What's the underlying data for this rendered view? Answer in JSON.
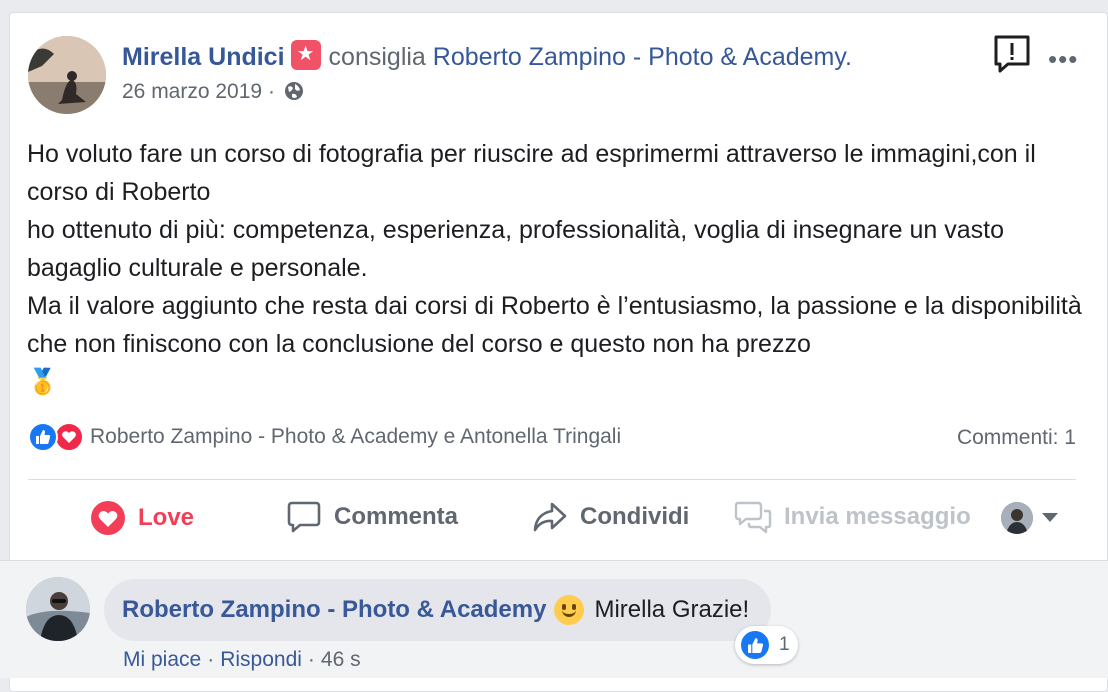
{
  "post": {
    "author": "Mirella Undici",
    "verb": "consiglia",
    "page": "Roberto Zampino - Photo & Academy.",
    "date": "26 marzo 2019",
    "date_sep": "·",
    "body": [
      "Ho voluto fare un corso di fotografia per riuscire ad esprimermi attraverso le immagini,con il corso di Roberto",
      "ho ottenuto di più: competenza, esperienza, professionalità, voglia di insegnare un vasto bagaglio culturale e personale.",
      "Ma il valore aggiunto che resta dai corsi di Roberto è l’entusiasmo, la passione e la disponibilità che non finiscono con la conclusione del corso e questo non ha prezzo",
      "🥇"
    ]
  },
  "reactions": {
    "names": "Roberto Zampino - Photo & Academy e Antonella Tringali",
    "comments_count": "Commenti: 1"
  },
  "actions": {
    "love": "Love",
    "comment": "Commenta",
    "share": "Condividi",
    "message": "Invia messaggio"
  },
  "comment": {
    "author": "Roberto Zampino - Photo & Academy",
    "text": "Mirella Grazie!",
    "like_count": "1",
    "like_label": "Mi piace",
    "reply_label": "Rispondi",
    "sep": "·",
    "time": "46 s"
  },
  "colors": {
    "link": "#365899",
    "love": "#f33e58",
    "like_blue": "#1877f2",
    "muted": "#606770"
  },
  "icons": [
    "recommend-star-icon",
    "globe-icon",
    "report-icon",
    "more-icon",
    "like-reaction-icon",
    "love-reaction-icon",
    "heart-icon",
    "comment-icon",
    "share-icon",
    "messenger-icon",
    "caret-down-icon",
    "grinning-face-icon",
    "medal-icon"
  ]
}
